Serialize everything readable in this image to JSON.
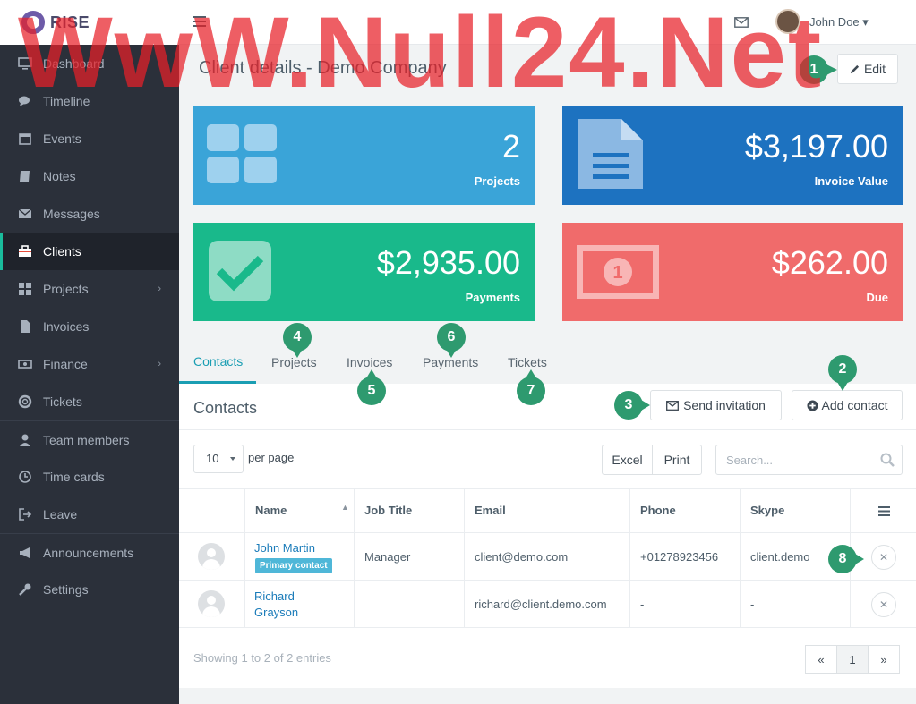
{
  "brand": {
    "name": "RISE"
  },
  "sidebar": {
    "items": [
      {
        "label": "Dashboard",
        "icon": "monitor-icon"
      },
      {
        "label": "Timeline",
        "icon": "comments-icon"
      },
      {
        "label": "Events",
        "icon": "calendar-icon"
      },
      {
        "label": "Notes",
        "icon": "book-icon"
      },
      {
        "label": "Messages",
        "icon": "envelope-icon"
      },
      {
        "label": "Clients",
        "icon": "briefcase-icon",
        "active": true
      },
      {
        "label": "Projects",
        "icon": "grid-icon",
        "has_submenu": true
      },
      {
        "label": "Invoices",
        "icon": "file-icon"
      },
      {
        "label": "Finance",
        "icon": "money-icon",
        "has_submenu": true
      },
      {
        "label": "Tickets",
        "icon": "lifebuoy-icon"
      },
      {
        "label": "Team members",
        "icon": "user-icon"
      },
      {
        "label": "Time cards",
        "icon": "clock-icon"
      },
      {
        "label": "Leave",
        "icon": "sign-out-icon"
      },
      {
        "label": "Announcements",
        "icon": "bullhorn-icon"
      },
      {
        "label": "Settings",
        "icon": "wrench-icon"
      }
    ]
  },
  "topbar": {
    "user_name": "John Doe"
  },
  "page": {
    "title": "Client details - Demo Company",
    "edit_label": "Edit"
  },
  "stats": [
    {
      "value": "2",
      "label": "Projects",
      "color": "#3aa4d8"
    },
    {
      "value": "$3,197.00",
      "label": "Invoice Value",
      "color": "#1d72c0"
    },
    {
      "value": "$2,935.00",
      "label": "Payments",
      "color": "#19b98b"
    },
    {
      "value": "$262.00",
      "label": "Due",
      "color": "#f06b6b"
    }
  ],
  "tabs": [
    "Contacts",
    "Projects",
    "Invoices",
    "Payments",
    "Tickets"
  ],
  "contacts": {
    "title": "Contacts",
    "send_invitation": "Send invitation",
    "add_contact": "Add contact",
    "page_size": "10",
    "per_page": "per page",
    "excel": "Excel",
    "print": "Print",
    "search_placeholder": "Search...",
    "columns": [
      "Name",
      "Job Title",
      "Email",
      "Phone",
      "Skype"
    ],
    "rows": [
      {
        "name": "John Martin",
        "badge": "Primary contact",
        "job_title": "Manager",
        "email": "client@demo.com",
        "phone": "+01278923456",
        "skype": "client.demo"
      },
      {
        "name_line1": "Richard",
        "name_line2": "Grayson",
        "job_title": "",
        "email": "richard@client.demo.com",
        "phone": "-",
        "skype": "-"
      }
    ],
    "showing": "Showing 1 to 2 of 2 entries",
    "pager": {
      "prev": "«",
      "current": "1",
      "next": "»"
    }
  },
  "steps": [
    "1",
    "2",
    "3",
    "4",
    "5",
    "6",
    "7",
    "8"
  ],
  "watermark": "WwW.Null24.Net",
  "colors": {
    "accent": "#1a9eb3",
    "step": "#2e9a6f",
    "sidebar": "#2b303a"
  }
}
